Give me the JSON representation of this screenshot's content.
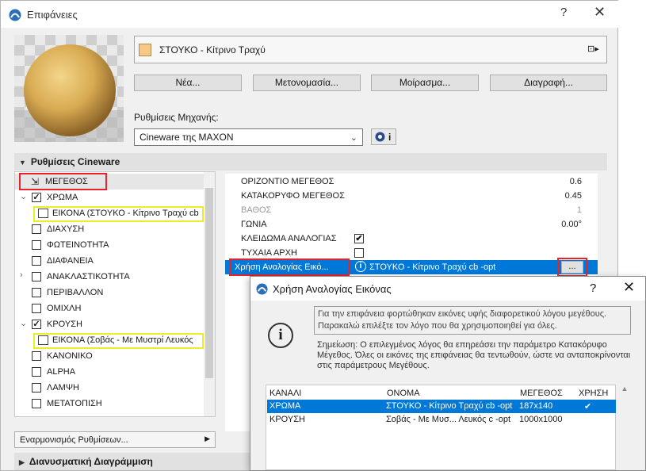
{
  "window": {
    "title": "Επιφάνειες",
    "help": "?",
    "close": "✕"
  },
  "surface": {
    "name": "ΣΤΟΥΚΟ - Κίτρινο Τραχύ",
    "swatch_color": "#f7c887",
    "menu_icon": "⊡▸"
  },
  "buttons": {
    "new": "Νέα...",
    "rename": "Μετονομασία...",
    "share": "Μοίρασμα...",
    "delete": "Διαγραφή..."
  },
  "engine": {
    "label": "Ρυθμίσεις Μηχανής:",
    "value": "Cineware της MAXON",
    "info": "i"
  },
  "section_cineware": "Ρυθμίσεις Cineware",
  "tree": {
    "size": "ΜΕΓΕΘΟΣ",
    "color": "ΧΡΩΜΑ",
    "color_image": "ΕΙΚΟΝΑ (ΣΤΟΥΚΟ - Κίτρινο Τραχύ cb",
    "diffusion": "ΔΙΑΧΥΣΗ",
    "luminance": "ΦΩΤΕΙΝΟΤΗΤΑ",
    "transparency": "ΔΙΑΦΑΝΕΙΑ",
    "reflectance": "ΑΝΑΚΛΑΣΤΙΚΟΤΗΤΑ",
    "environment": "ΠΕΡΙΒΑΛΛΟΝ",
    "fog": "ΟΜΙΧΛΗ",
    "bump": "ΚΡΟΥΣΗ",
    "bump_image": "ΕΙΚΟΝΑ (Σοβάς - Με Μυστρί Λευκός",
    "normal": "ΚΑΝΟΝΙΚΟ",
    "alpha": "ALPHA",
    "glow": "ΛΑΜΨΗ",
    "displacement": "ΜΕΤΑΤΟΠΙΣΗ"
  },
  "sync_settings": "Εναρμονισμός Ρυθμίσεων...",
  "section_vector": "Διανυσματική Διαγράμμιση",
  "props": {
    "h_size": {
      "label": "ΟΡΙΖΟΝΤΙΟ ΜΕΓΕΘΟΣ",
      "value": "0.6"
    },
    "v_size": {
      "label": "ΚΑΤΑΚΟΡΥΦΟ ΜΕΓΕΘΟΣ",
      "value": "0.45"
    },
    "depth": {
      "label": "ΒΑΘΟΣ",
      "value": "1"
    },
    "angle": {
      "label": "ΓΩΝΙΑ",
      "value": "0.00°"
    },
    "lock_ratio": {
      "label": "ΚΛΕΙΔΩΜΑ ΑΝΑΛΟΓΙΑΣ",
      "checked": "✔"
    },
    "random_origin": {
      "label": "ΤΥΧΑΙΑ ΑΡΧΗ"
    },
    "use_ratio": {
      "label": "Χρήση Αναλογίας Εικό...",
      "value": "ΣΤΟΥΚΟ - Κίτρινο Τραχύ cb -opt",
      "button": "..."
    }
  },
  "dialog": {
    "title": "Χρήση Αναλογίας Εικόνας",
    "help": "?",
    "close": "✕",
    "icon": "i",
    "message": "Για την επιφάνεια φορτώθηκαν εικόνες υφής διαφορετικού λόγου μεγέθους. Παρακαλώ επιλέξτε τον λόγο που θα χρησιμοποιηθεί για όλες.",
    "note": "Σημείωση: Ο επιλεγμένος λόγος θα επηρεάσει την παράμετρο Κατακόρυφο Μέγεθος. Όλες οι εικόνες της επιφάνειας θα τεντωθούν, ώστε να ανταποκρίνονται στις παράμετρους Μεγέθους.",
    "columns": [
      "ΚΑΝΑΛΙ",
      "ΟΝΟΜΑ",
      "ΜΕΓΕΘΟΣ",
      "ΧΡΗΣΗ"
    ],
    "rows": [
      {
        "channel": "ΧΡΩΜΑ",
        "name": "ΣΤΟΥΚΟ - Κίτρινο Τραχύ cb -opt",
        "size": "187x140",
        "use": "✔"
      },
      {
        "channel": "ΚΡΟΥΣΗ",
        "name": "Σοβάς - Με Μυσ... Λευκός c -opt",
        "size": "1000x1000",
        "use": ""
      }
    ]
  },
  "colors": {
    "selection": "#0078d7",
    "highlight_red": "#e8222a",
    "highlight_yellow": "#ecec2b"
  }
}
